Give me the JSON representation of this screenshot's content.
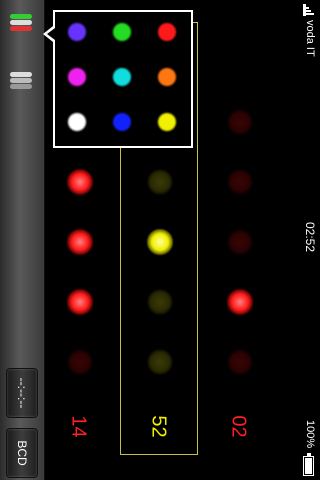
{
  "status_bar": {
    "carrier": "voda IT",
    "time": "02:52",
    "battery": "100%"
  },
  "toolbar": {
    "time_format_label": "--:--:--",
    "bcd_label": "BCD"
  },
  "display": {
    "digits": [
      "14",
      "52",
      "02"
    ],
    "digit_colors": [
      "#ff2020",
      "#f0f000",
      "#ff2020"
    ]
  },
  "led_columns": [
    {
      "color": "red",
      "states": [
        false,
        true,
        true,
        true,
        false
      ]
    },
    {
      "color": "yellow",
      "states": [
        false,
        false,
        true,
        false,
        false
      ]
    },
    {
      "color": "red",
      "states": [
        false,
        false,
        false,
        true,
        false
      ]
    }
  ],
  "palette": {
    "colors": [
      "#6633ff",
      "#22dd22",
      "#ff1a1a",
      "#ee22ee",
      "#11dddd",
      "#ff7711",
      "#ffffff",
      "#1122ff",
      "#f0f000"
    ]
  }
}
